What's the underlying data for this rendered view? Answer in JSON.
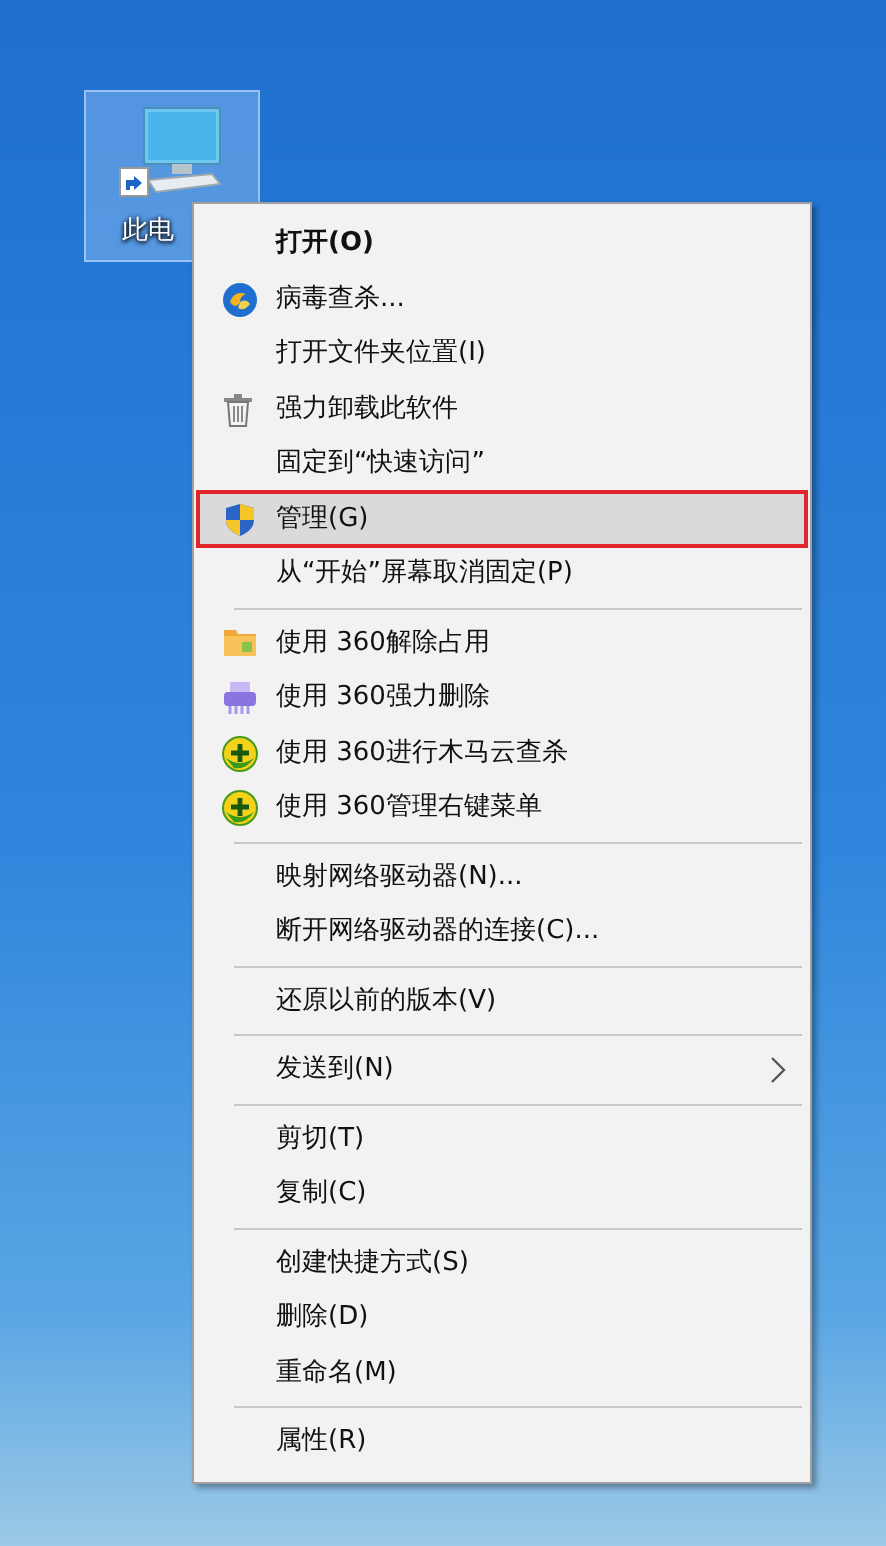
{
  "desktop_icon": {
    "label": "此电",
    "selected": true
  },
  "context_menu": {
    "sections": [
      {
        "items": [
          {
            "label": "打开(O)",
            "is_default": true,
            "selected": false
          },
          {
            "label": "病毒查杀...",
            "is_default": false,
            "selected": false,
            "kind": "orb"
          },
          {
            "label": "打开文件夹位置(I)",
            "is_default": false,
            "selected": false
          },
          {
            "label": "强力卸载此软件",
            "is_default": false,
            "selected": false,
            "kind": "trash"
          },
          {
            "label": "固定到“快速访问”",
            "is_default": false,
            "selected": false
          },
          {
            "label": "管理(G)",
            "is_default": false,
            "selected": true,
            "outlined": true,
            "kind": "shield"
          },
          {
            "label": "从“开始”屏幕取消固定(P)",
            "is_default": false,
            "selected": false
          }
        ]
      },
      {
        "items": [
          {
            "label": "使用 360解除占用",
            "is_default": false,
            "selected": false,
            "kind": "folder"
          },
          {
            "label": "使用 360强力删除",
            "is_default": false,
            "selected": false,
            "kind": "shredder"
          },
          {
            "label": "使用 360进行木马云查杀",
            "is_default": false,
            "selected": false,
            "kind": "plus"
          },
          {
            "label": "使用 360管理右键菜单",
            "is_default": false,
            "selected": false,
            "kind": "plus"
          }
        ]
      },
      {
        "items": [
          {
            "label": "映射网络驱动器(N)...",
            "is_default": false,
            "selected": false
          },
          {
            "label": "断开网络驱动器的连接(C)...",
            "is_default": false,
            "selected": false
          }
        ]
      },
      {
        "items": [
          {
            "label": "还原以前的版本(V)",
            "is_default": false,
            "selected": false
          }
        ]
      },
      {
        "items": [
          {
            "label": "发送到(N)",
            "is_default": false,
            "selected": false,
            "submenu": true
          }
        ]
      },
      {
        "items": [
          {
            "label": "剪切(T)",
            "is_default": false,
            "selected": false
          },
          {
            "label": "复制(C)",
            "is_default": false,
            "selected": false
          }
        ]
      },
      {
        "items": [
          {
            "label": "创建快捷方式(S)",
            "is_default": false,
            "selected": false
          },
          {
            "label": "删除(D)",
            "is_default": false,
            "selected": false
          },
          {
            "label": "重命名(M)",
            "is_default": false,
            "selected": false
          }
        ]
      },
      {
        "items": [
          {
            "label": "属性(R)",
            "is_default": false,
            "selected": false
          }
        ]
      }
    ]
  }
}
